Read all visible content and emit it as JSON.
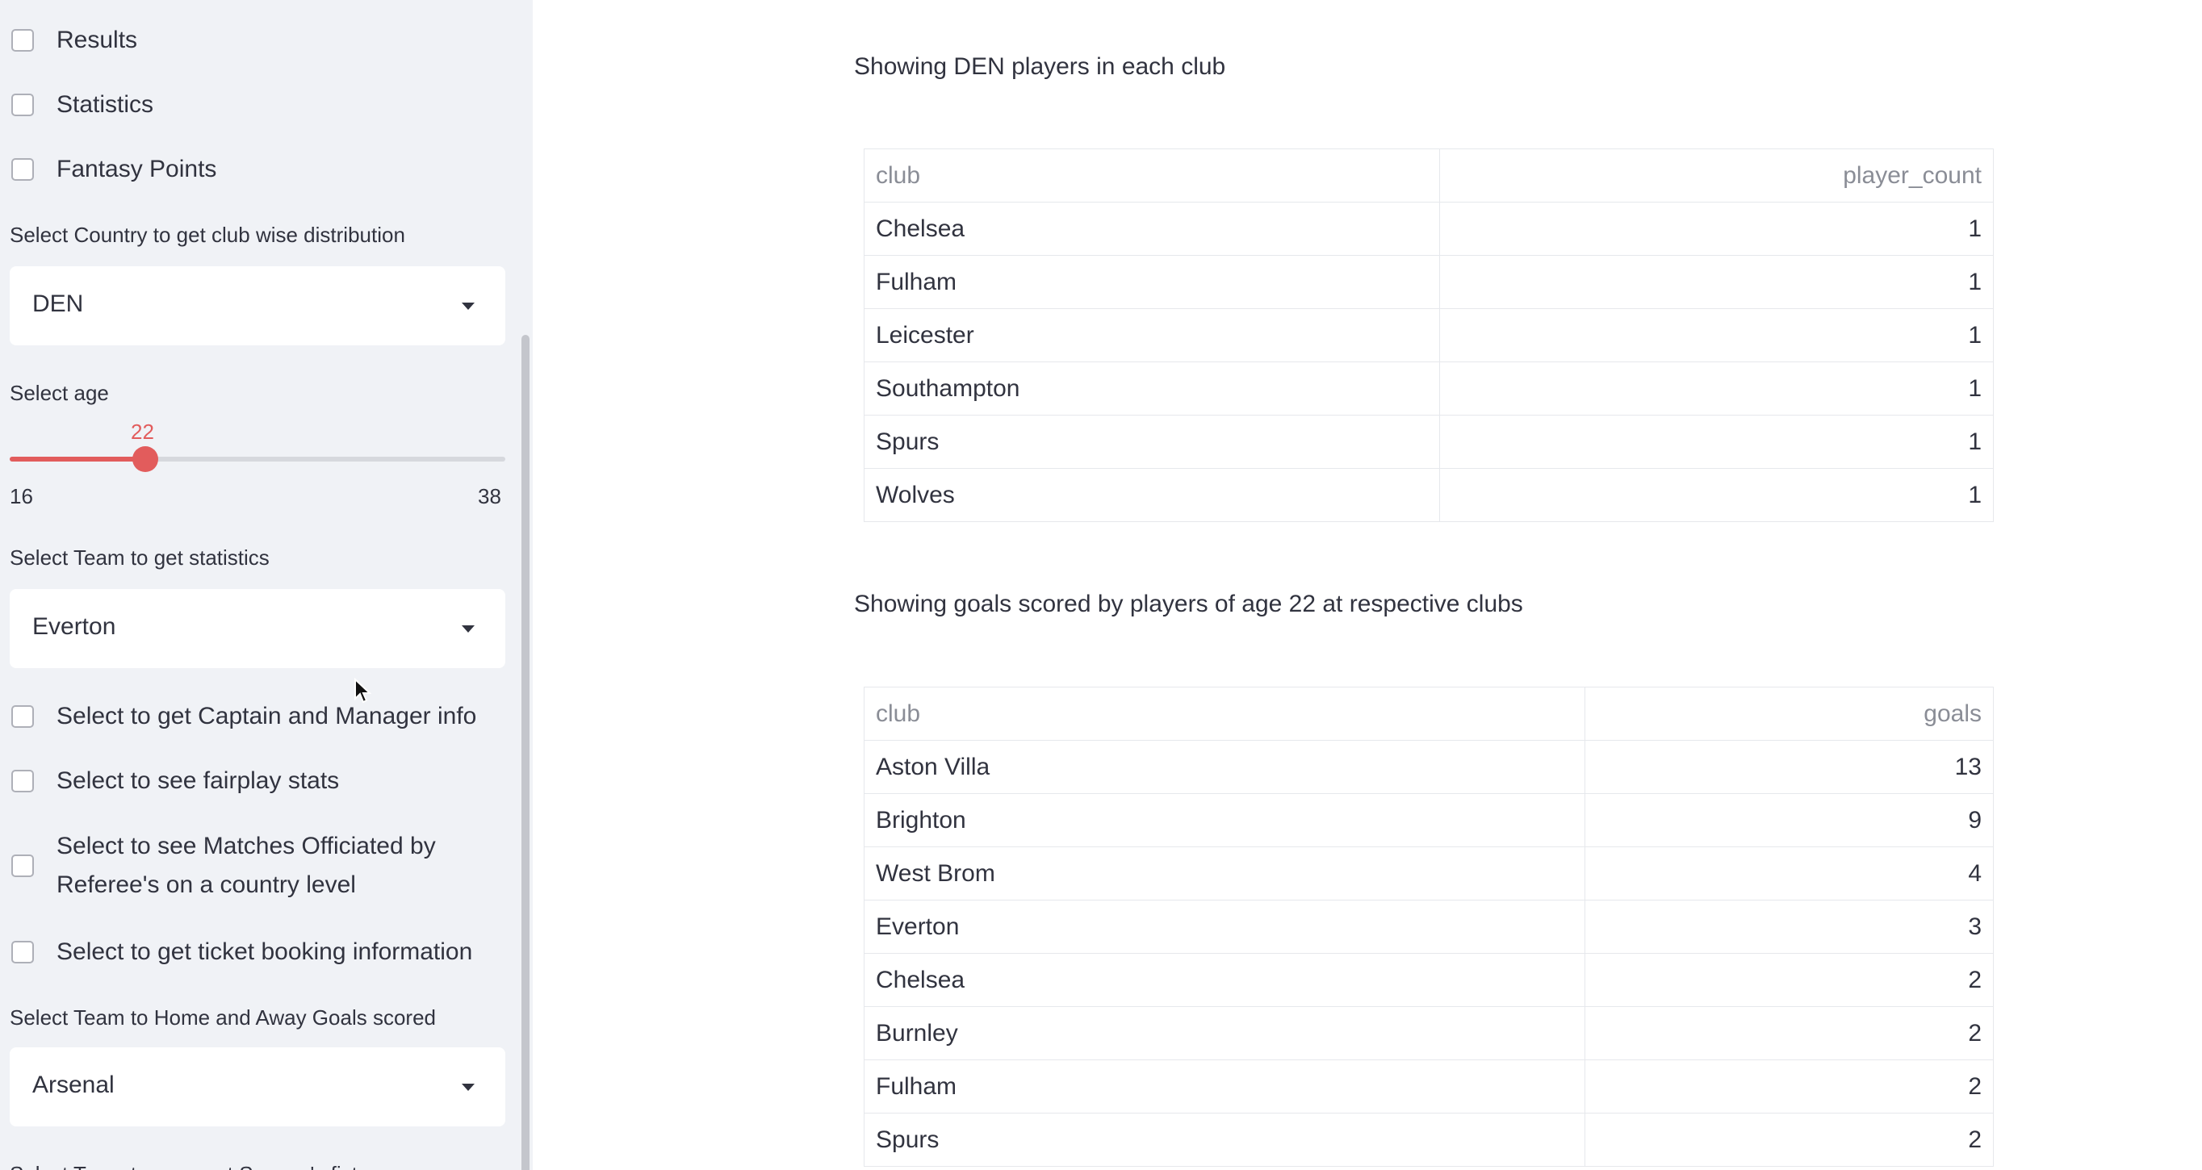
{
  "sidebar": {
    "checkboxes_top": [
      "Results",
      "Statistics",
      "Fantasy Points"
    ],
    "country_select": {
      "label": "Select Country to get club wise distribution",
      "value": "DEN"
    },
    "age_slider": {
      "label": "Select age",
      "value": "22",
      "min": "16",
      "max": "38"
    },
    "team_stats_select": {
      "label": "Select Team to get statistics",
      "value": "Everton"
    },
    "option_checkboxes": [
      "Select to get Captain and Manager info",
      "Select to see fairplay stats",
      "Select to see Matches Officiated by Referee's on a country level",
      "Select to get ticket booking information"
    ],
    "home_away_select": {
      "label": "Select Team to Home and Away Goals scored",
      "value": "Arsenal"
    },
    "fixtures_label": "Select Team to see next Season's fixtures"
  },
  "main": {
    "players_caption": "Showing DEN players in each club",
    "players_table": {
      "columns": [
        "club",
        "player_count"
      ],
      "rows": [
        [
          "Chelsea",
          "1"
        ],
        [
          "Fulham",
          "1"
        ],
        [
          "Leicester",
          "1"
        ],
        [
          "Southampton",
          "1"
        ],
        [
          "Spurs",
          "1"
        ],
        [
          "Wolves",
          "1"
        ]
      ]
    },
    "goals_caption": "Showing goals scored by players of age 22 at respective clubs",
    "goals_table": {
      "columns": [
        "club",
        "goals"
      ],
      "rows": [
        [
          "Aston Villa",
          "13"
        ],
        [
          "Brighton",
          "9"
        ],
        [
          "West Brom",
          "4"
        ],
        [
          "Everton",
          "3"
        ],
        [
          "Chelsea",
          "2"
        ],
        [
          "Burnley",
          "2"
        ],
        [
          "Fulham",
          "2"
        ],
        [
          "Spurs",
          "2"
        ]
      ]
    }
  },
  "colors": {
    "accent": "#E25C5C",
    "sidebar_bg": "#F0F2F6",
    "text": "#31333F"
  }
}
